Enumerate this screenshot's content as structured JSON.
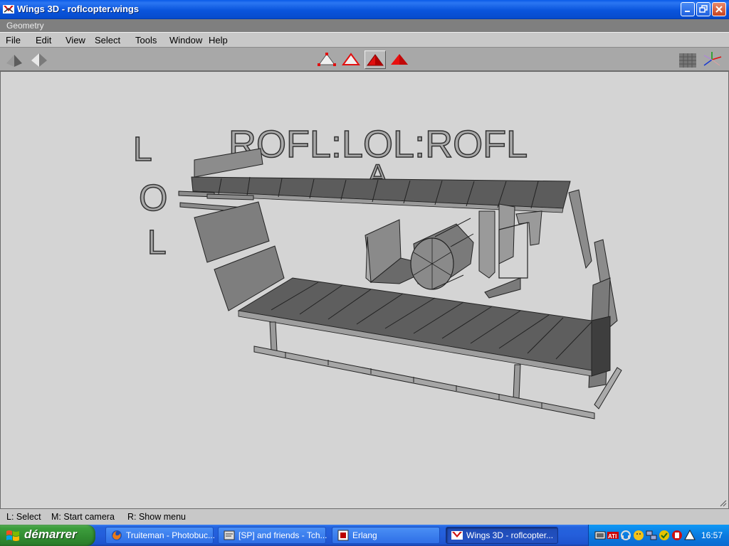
{
  "window": {
    "title": "Wings 3D - roflcopter.wings",
    "controls": [
      "minimize-icon",
      "restore-icon",
      "close-icon"
    ]
  },
  "geometry_label": "Geometry",
  "menu": [
    {
      "label": "File"
    },
    {
      "label": "Edit"
    },
    {
      "label": "View"
    },
    {
      "label": "Select"
    },
    {
      "label": "Tools"
    },
    {
      "label": "Window"
    },
    {
      "label": "Help"
    }
  ],
  "toolbar": {
    "left": [
      "smooth-preview-icon",
      "wireframe-toggle-icon"
    ],
    "select_modes": [
      {
        "icon": "vertex-select-icon",
        "active": false
      },
      {
        "icon": "edge-select-icon",
        "active": false
      },
      {
        "icon": "face-select-icon",
        "active": true
      },
      {
        "icon": "body-select-icon",
        "active": false
      }
    ],
    "right": [
      "ground-plane-icon",
      "axes-icon"
    ]
  },
  "scene": {
    "texts": [
      "ROFL:LOL:ROFL",
      "L",
      "O",
      "L",
      "A"
    ]
  },
  "status": {
    "left": "L: Select",
    "middle": "M: Start camera",
    "right": "R: Show menu"
  },
  "taskbar": {
    "start_label": "démarrer",
    "tasks": [
      {
        "label": "Truiteman - Photobuc...",
        "icon": "firefox-icon",
        "active": false
      },
      {
        "label": "[SP] and friends - Tch...",
        "icon": "chat-icon",
        "active": false
      },
      {
        "label": "Erlang",
        "icon": "erlang-icon",
        "active": false
      },
      {
        "label": "Wings 3D - roflcopter...",
        "icon": "wings3d-icon",
        "active": true
      }
    ],
    "tray_icons": [
      "tray-app-icon",
      "ati-icon",
      "headset-icon",
      "messenger-icon",
      "network-icon",
      "security-icon",
      "tray-red-icon",
      "tray-white-icon"
    ],
    "clock": "16:57"
  },
  "colors": {
    "titlebar": "#0a5be8",
    "viewport_bg": "#d4d4d4",
    "selection_red": "#e01010",
    "taskbar": "#245edb",
    "start_green": "#3d9e3d"
  }
}
